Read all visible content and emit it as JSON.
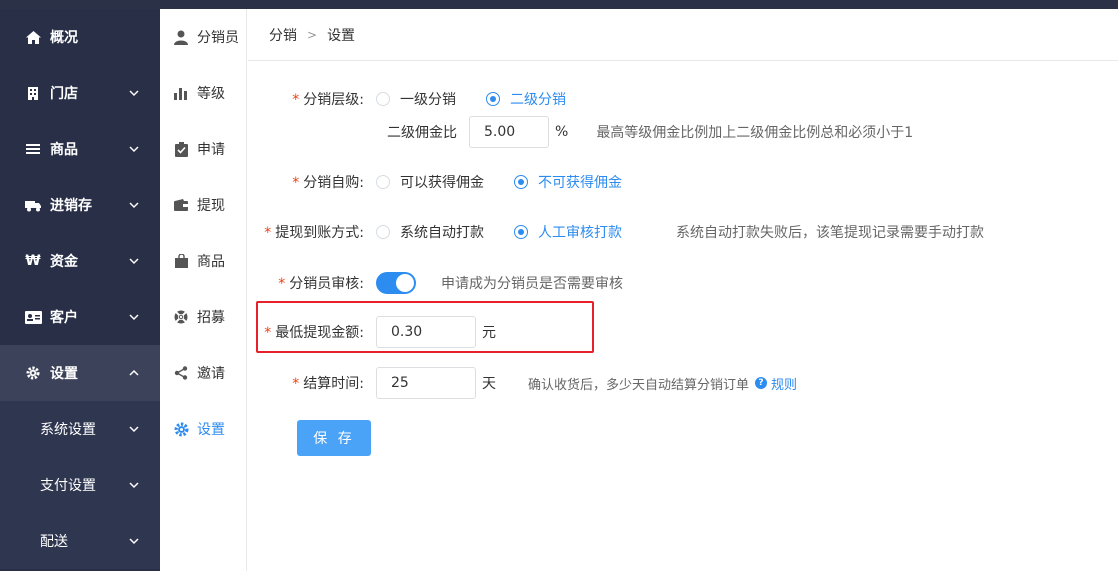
{
  "sidebar": {
    "items": [
      {
        "label": "概况",
        "icon": "home-icon"
      },
      {
        "label": "门店",
        "icon": "building-icon"
      },
      {
        "label": "商品",
        "icon": "list-icon"
      },
      {
        "label": "进销存",
        "icon": "truck-icon"
      },
      {
        "label": "资金",
        "icon": "won-icon"
      },
      {
        "label": "客户",
        "icon": "id-card-icon"
      },
      {
        "label": "设置",
        "icon": "gear-icon"
      }
    ],
    "sub_items": [
      {
        "label": "系统设置"
      },
      {
        "label": "支付设置"
      },
      {
        "label": "配送"
      }
    ]
  },
  "subnav": {
    "items": [
      {
        "label": "分销员",
        "icon": "user-icon"
      },
      {
        "label": "等级",
        "icon": "bar-chart-icon"
      },
      {
        "label": "申请",
        "icon": "clipboard-icon"
      },
      {
        "label": "提现",
        "icon": "wallet-icon"
      },
      {
        "label": "商品",
        "icon": "bag-icon"
      },
      {
        "label": "招募",
        "icon": "lifebuoy-icon"
      },
      {
        "label": "邀请",
        "icon": "share-icon"
      },
      {
        "label": "设置",
        "icon": "gear-icon"
      }
    ]
  },
  "breadcrumb": {
    "parent": "分销",
    "current": "设置"
  },
  "form": {
    "level": {
      "label": "分销层级:",
      "options": [
        "一级分销",
        "二级分销"
      ],
      "selected": "二级分销"
    },
    "commission": {
      "label": "二级佣金比",
      "value": "5.00",
      "unit": "%",
      "hint": "最高等级佣金比例加上二级佣金比例总和必须小于1"
    },
    "self_purchase": {
      "label": "分销自购:",
      "options": [
        "可以获得佣金",
        "不可获得佣金"
      ],
      "selected": "不可获得佣金"
    },
    "withdraw_method": {
      "label": "提现到账方式:",
      "options": [
        "系统自动打款",
        "人工审核打款"
      ],
      "selected": "人工审核打款",
      "hint": "系统自动打款失败后，该笔提现记录需要手动打款"
    },
    "review": {
      "label": "分销员审核:",
      "enabled": true,
      "hint": "申请成为分销员是否需要审核"
    },
    "min_withdraw": {
      "label": "最低提现金额:",
      "value": "0.30",
      "unit": "元"
    },
    "settle_time": {
      "label": "结算时间:",
      "value": "25",
      "unit": "天",
      "hint": "确认收货后，多少天自动结算分销订单",
      "link": "规则"
    },
    "save_label": "保 存"
  },
  "colors": {
    "accent": "#2d8cf0",
    "sidebar": "#282f47",
    "highlight": "#e8202a",
    "required": "#ed4014"
  }
}
